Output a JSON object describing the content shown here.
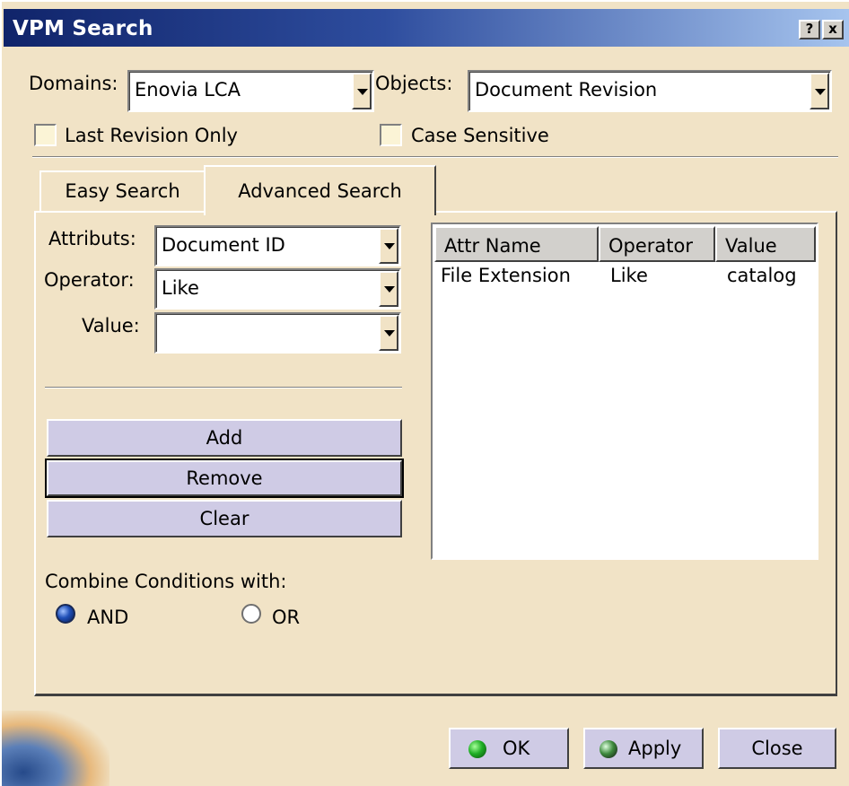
{
  "window": {
    "title": "VPM Search",
    "help_label": "?",
    "close_label": "x"
  },
  "top": {
    "domains_label": "Domains:",
    "domains_value": "Enovia LCA",
    "objects_label": "Objects:",
    "objects_value": "Document Revision",
    "last_revision_label": "Last Revision Only",
    "last_revision_checked": false,
    "case_sensitive_label": "Case Sensitive",
    "case_sensitive_checked": false
  },
  "tabs": [
    {
      "label": "Easy Search",
      "active": false
    },
    {
      "label": "Advanced Search",
      "active": true
    }
  ],
  "advanced": {
    "attributs_label": "Attributs:",
    "attributs_value": "Document ID",
    "operator_label": "Operator:",
    "operator_value": "Like",
    "value_label": "Value:",
    "value_value": "",
    "add_label": "Add",
    "remove_label": "Remove",
    "clear_label": "Clear",
    "combine_label": "Combine Conditions with:",
    "and_label": "AND",
    "or_label": "OR",
    "selected_combine": "AND"
  },
  "conditions": {
    "columns": [
      "Attr Name",
      "Operator",
      "Value"
    ],
    "rows": [
      [
        "File Extension",
        "Like",
        "catalog"
      ]
    ]
  },
  "footer": {
    "ok_label": "OK",
    "apply_label": "Apply",
    "close_label": "Close"
  },
  "colors": {
    "dialog_bg": "#f1e3c6",
    "button_bg": "#cfcbe5",
    "title_start": "#10246a",
    "title_end": "#a6c4ee"
  }
}
